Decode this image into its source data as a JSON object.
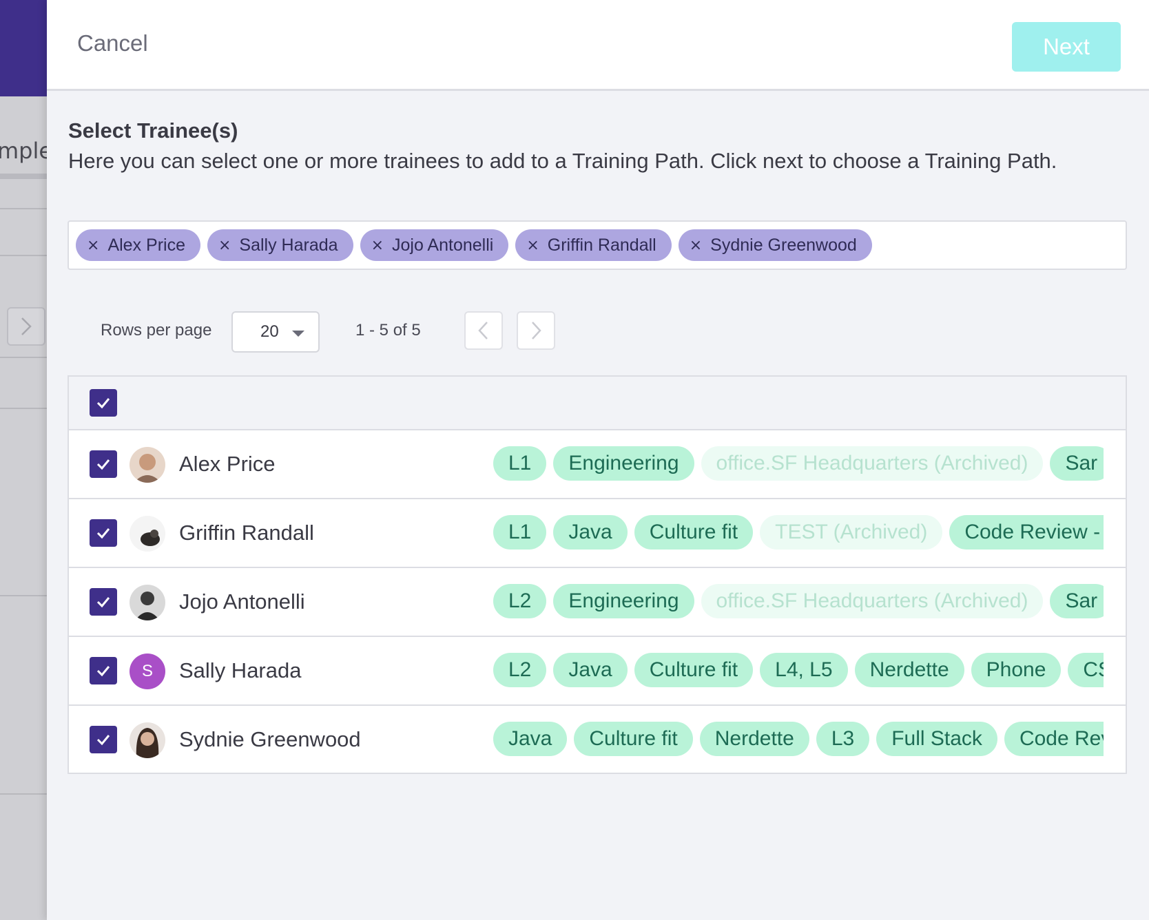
{
  "background": {
    "tab_text": "mplet"
  },
  "header": {
    "cancel_label": "Cancel",
    "next_label": "Next"
  },
  "section": {
    "title": "Select Trainee(s)",
    "description": "Here you can select one or more trainees to add to a Training Path. Click next to choose a Training Path."
  },
  "selected_chips": [
    "Alex Price",
    "Sally Harada",
    "Jojo Antonelli",
    "Griffin Randall",
    "Sydnie Greenwood"
  ],
  "pagination": {
    "rows_label": "Rows per page",
    "rows_value": "20",
    "range_text": "1 - 5 of 5"
  },
  "colors": {
    "brand_purple": "#3f2f8a",
    "chip_purple": "#ada6e0",
    "next_button": "#9ff0ee",
    "tag_green": "#b9f3d8",
    "tag_archived": "#ecfbf4"
  },
  "rows": [
    {
      "name": "Alex Price",
      "avatar": "photo-avatar",
      "tags": [
        {
          "label": "L1",
          "archived": false
        },
        {
          "label": "Engineering",
          "archived": false
        },
        {
          "label": "office.SF Headquarters (Archived)",
          "archived": true
        },
        {
          "label": "Sar",
          "archived": false
        }
      ]
    },
    {
      "name": "Griffin Randall",
      "avatar": "photo-avatar",
      "tags": [
        {
          "label": "L1",
          "archived": false
        },
        {
          "label": "Java",
          "archived": false
        },
        {
          "label": "Culture fit",
          "archived": false
        },
        {
          "label": "TEST (Archived)",
          "archived": true
        },
        {
          "label": "Code Review - F",
          "archived": false
        }
      ]
    },
    {
      "name": "Jojo Antonelli",
      "avatar": "photo-avatar",
      "tags": [
        {
          "label": "L2",
          "archived": false
        },
        {
          "label": "Engineering",
          "archived": false
        },
        {
          "label": "office.SF Headquarters (Archived)",
          "archived": true
        },
        {
          "label": "Sar",
          "archived": false
        }
      ]
    },
    {
      "name": "Sally Harada",
      "avatar": "S",
      "tags": [
        {
          "label": "L2",
          "archived": false
        },
        {
          "label": "Java",
          "archived": false
        },
        {
          "label": "Culture fit",
          "archived": false
        },
        {
          "label": "L4, L5",
          "archived": false
        },
        {
          "label": "Nerdette",
          "archived": false
        },
        {
          "label": "Phone",
          "archived": false
        },
        {
          "label": "CS",
          "archived": false
        }
      ]
    },
    {
      "name": "Sydnie Greenwood",
      "avatar": "photo-avatar",
      "tags": [
        {
          "label": "Java",
          "archived": false
        },
        {
          "label": "Culture fit",
          "archived": false
        },
        {
          "label": "Nerdette",
          "archived": false
        },
        {
          "label": "L3",
          "archived": false
        },
        {
          "label": "Full Stack",
          "archived": false
        },
        {
          "label": "Code Rev",
          "archived": false
        }
      ]
    }
  ]
}
